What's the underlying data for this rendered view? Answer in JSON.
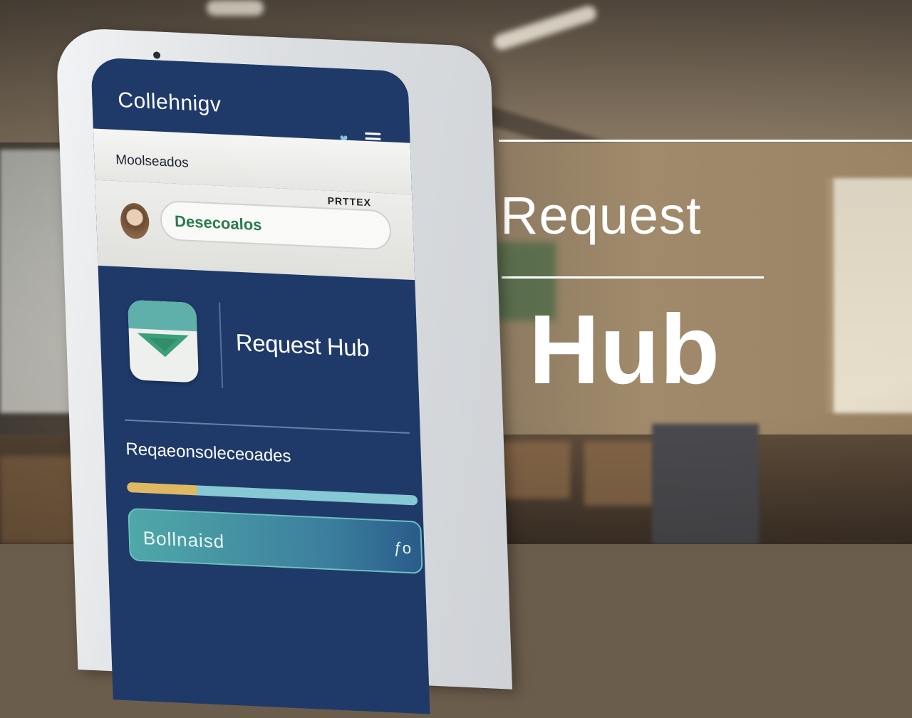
{
  "headline": {
    "line1": "Request",
    "line2": "Hub"
  },
  "app": {
    "title": "Collehnigv",
    "subtitle": "Moolseados",
    "filter_label": "PRTTEX",
    "search_value": "Desecoalos",
    "hub_title": "Request Hub",
    "requests_heading": "Reqaeonsoleceoades",
    "progress_fraction": 0.24,
    "bottom_card_text": "Bollnaisd",
    "bottom_card_action": "ƒo"
  },
  "icons": {
    "heart": "heart-icon",
    "menu": "menu-icon",
    "avatar": "avatar",
    "hub_logo": "hub-logo-icon"
  },
  "colors": {
    "app_blue": "#1f3a69",
    "accent_green": "#2a7a4d",
    "teal": "#5fb0aa",
    "progress_track": "#86c8d4",
    "progress_fill": "#e0b860"
  }
}
